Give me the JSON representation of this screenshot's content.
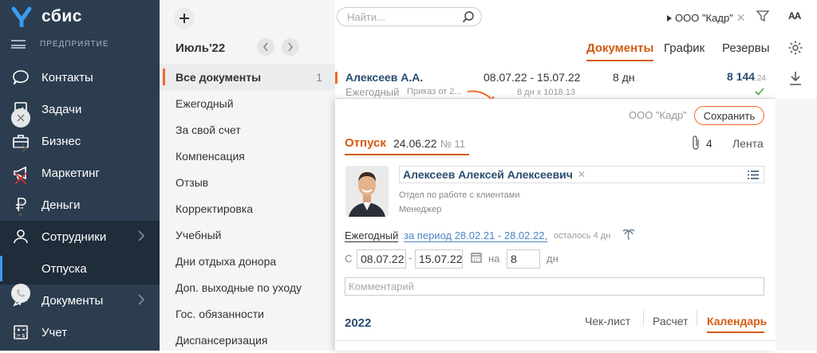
{
  "sidebar": {
    "logo": "сбис",
    "subtitle": "ПРЕДПРИЯТИЕ",
    "items": [
      {
        "label": "Контакты",
        "icon": "contacts-icon"
      },
      {
        "label": "Задачи",
        "icon": "tasks-icon"
      },
      {
        "label": "Бизнес",
        "icon": "briefcase-icon"
      },
      {
        "label": "Маркетинг",
        "icon": "megaphone-icon"
      },
      {
        "label": "Деньги",
        "icon": "ruble-icon"
      },
      {
        "label": "Сотрудники",
        "icon": "employees-icon"
      },
      {
        "label": "Отпуска",
        "icon": ""
      },
      {
        "label": "Документы",
        "icon": "document-icon"
      },
      {
        "label": "Учет",
        "icon": "accounting-icon"
      }
    ]
  },
  "period": {
    "label": "Июль'22"
  },
  "categories": [
    {
      "label": "Все документы",
      "count": "1"
    },
    {
      "label": "Ежегодный",
      "count": ""
    },
    {
      "label": "За свой счет",
      "count": ""
    },
    {
      "label": "Компенсация",
      "count": ""
    },
    {
      "label": "Отзыв",
      "count": ""
    },
    {
      "label": "Корректировка",
      "count": ""
    },
    {
      "label": "Учебный",
      "count": ""
    },
    {
      "label": "Дни отдыха донора",
      "count": ""
    },
    {
      "label": "Доп. выходные по уходу",
      "count": ""
    },
    {
      "label": "Гос. обязанности",
      "count": ""
    },
    {
      "label": "Диспансеризация",
      "count": ""
    }
  ],
  "header": {
    "search_placeholder": "Найти...",
    "org": "ООО \"Кадр\"",
    "font_toggle": "AA",
    "tabs": [
      "Документы",
      "График",
      "Резервы"
    ]
  },
  "list_row": {
    "name": "Алексеев А.А.",
    "period": "08.07.22 - 15.07.22",
    "days": "8 дн",
    "amount": "8 144",
    "amount_frac": ",24",
    "type": "Ежегодный",
    "order": "Приказ от 2...",
    "calc": "8 дн х 1018.13"
  },
  "panel": {
    "org": "ООО \"Кадр\"",
    "save": "Сохранить",
    "doc_title": "Отпуск",
    "doc_date": "24.06.22",
    "doc_num": "№ 11",
    "attachments": "4",
    "feed": "Лента",
    "employee": "Алексеев Алексей Алексеевич",
    "department": "Отдел по работе с клиентами",
    "position": "Менеджер",
    "vac_type": "Ежегодный",
    "vac_period": "за период 28.02.21 - 28.02.22,",
    "remaining": "осталось 4 дн",
    "from_label": "С",
    "date_from": "08.07.22",
    "date_to": "15.07.22",
    "on_label": "на",
    "days_value": "8",
    "days_unit": "дн",
    "comment_placeholder": "Комментарий",
    "year": "2022",
    "bottom_tabs": [
      "Чек-лист",
      "Расчет",
      "Календарь"
    ]
  }
}
